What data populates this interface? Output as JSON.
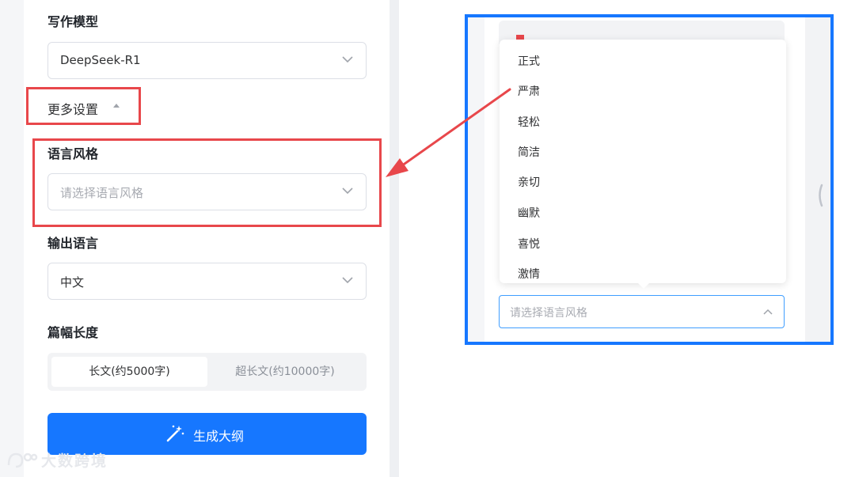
{
  "left_panel": {
    "model_label": "写作模型",
    "model_value": "DeepSeek-R1",
    "more_settings": "更多设置",
    "style_label": "语言风格",
    "style_placeholder": "请选择语言风格",
    "output_lang_label": "输出语言",
    "output_lang_value": "中文",
    "length_label": "篇幅长度",
    "length_options": [
      "长文(约5000字)",
      "超长文(约10000字)"
    ],
    "length_selected": "长文(约5000字)",
    "generate_button": "生成大纲"
  },
  "right_panel": {
    "dropdown_options": [
      "正式",
      "严肃",
      "轻松",
      "简洁",
      "亲切",
      "幽默",
      "喜悦",
      "激情"
    ],
    "select_placeholder": "请选择语言风格"
  },
  "watermark": "大数跨境",
  "colors": {
    "primary": "#1677ff",
    "annotation_red": "#e8474b",
    "annotation_blue": "#1677ff"
  },
  "icons": {
    "select_chevron": "chevron-down-icon",
    "more_settings_toggle": "triangle-up-icon",
    "generate": "magic-wand-icon",
    "open_select_chevron": "chevron-up-icon"
  }
}
